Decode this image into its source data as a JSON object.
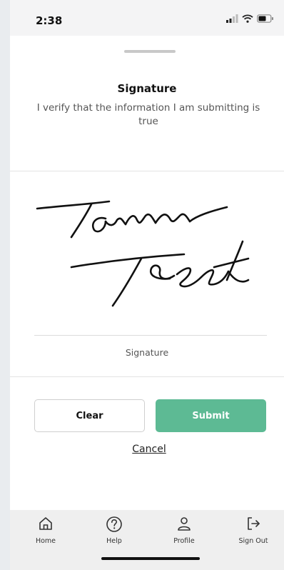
{
  "status_bar": {
    "time": "2:38"
  },
  "header": {
    "title": "Signature",
    "subtitle": "I verify that the information I am submitting is true"
  },
  "signature_pad": {
    "caption": "Signature"
  },
  "actions": {
    "clear_label": "Clear",
    "submit_label": "Submit",
    "cancel_label": "Cancel"
  },
  "tab_bar": {
    "items": [
      {
        "label": "Home",
        "icon": "home-icon"
      },
      {
        "label": "Help",
        "icon": "help-icon"
      },
      {
        "label": "Profile",
        "icon": "profile-icon"
      },
      {
        "label": "Sign Out",
        "icon": "sign-out-icon"
      }
    ]
  },
  "colors": {
    "accent": "#5dba94",
    "tab_bar_bg": "#efefef"
  }
}
